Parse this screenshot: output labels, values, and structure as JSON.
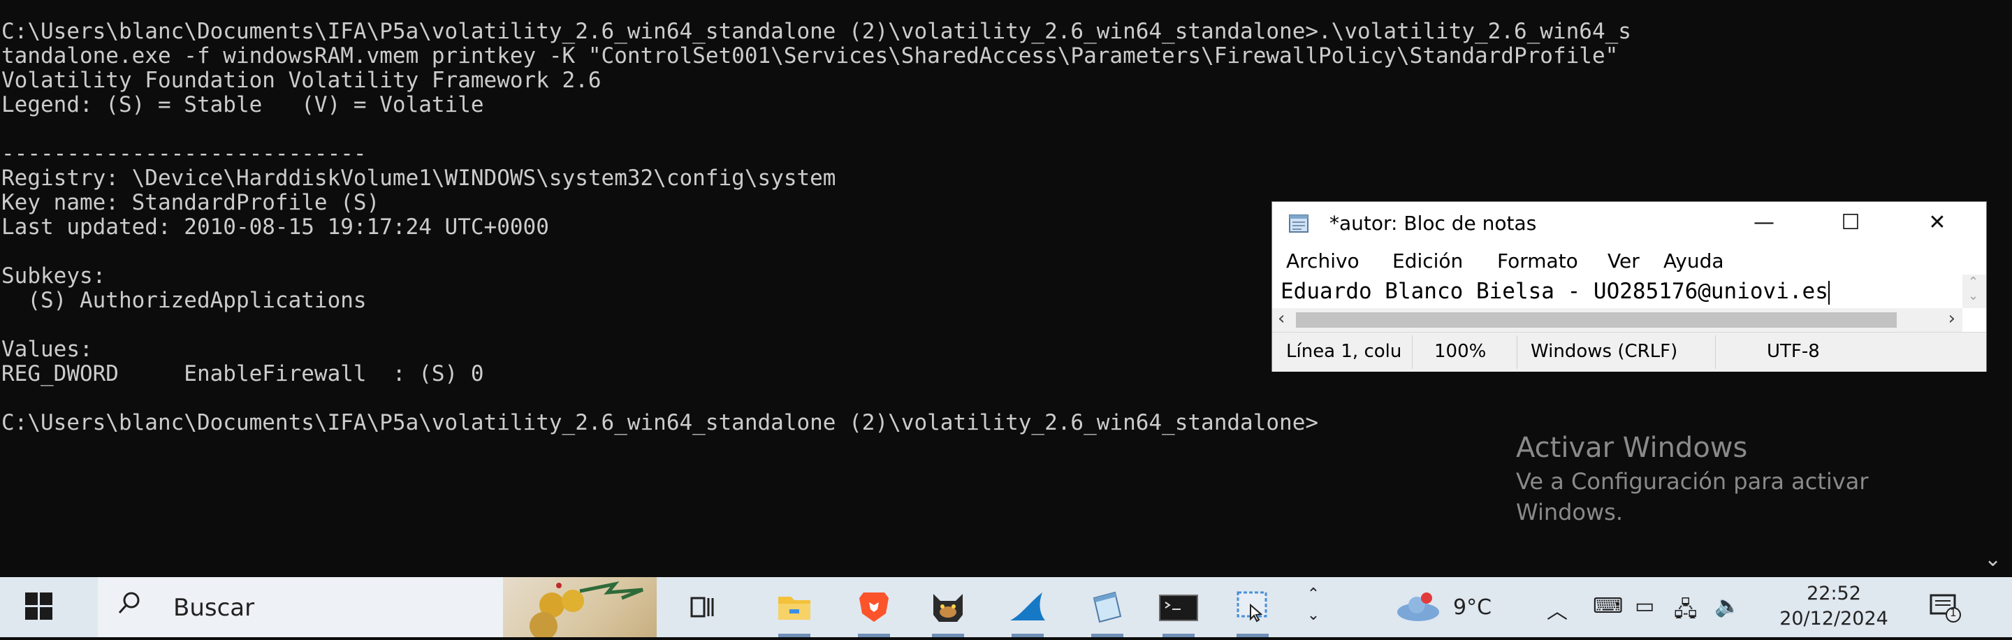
{
  "console": {
    "lines": [
      "C:\\Users\\blanc\\Documents\\IFA\\P5a\\volatility_2.6_win64_standalone (2)\\volatility_2.6_win64_standalone>.\\volatility_2.6_win64_s",
      "tandalone.exe -f windowsRAM.vmem printkey -K \"ControlSet001\\Services\\SharedAccess\\Parameters\\FirewallPolicy\\StandardProfile\"",
      "Volatility Foundation Volatility Framework 2.6",
      "Legend: (S) = Stable   (V) = Volatile",
      "",
      "----------------------------",
      "Registry: \\Device\\HarddiskVolume1\\WINDOWS\\system32\\config\\system",
      "Key name: StandardProfile (S)",
      "Last updated: 2010-08-15 19:17:24 UTC+0000",
      "",
      "Subkeys:",
      "  (S) AuthorizedApplications",
      "",
      "Values:",
      "REG_DWORD     EnableFirewall  : (S) 0",
      "",
      "C:\\Users\\blanc\\Documents\\IFA\\P5a\\volatility_2.6_win64_standalone (2)\\volatility_2.6_win64_standalone>"
    ],
    "background": "#0c0c0c",
    "foreground": "#cccccc"
  },
  "watermark": {
    "title": "Activar Windows",
    "subtitle": "Ve a Configuración para activar Windows."
  },
  "notepad": {
    "title": "*autor: Bloc de notas",
    "menu": [
      "Archivo",
      "Edición",
      "Formato",
      "Ver",
      "Ayuda"
    ],
    "content": "Eduardo Blanco Bielsa - UO285176@uniovi.es",
    "status": {
      "position": "Línea 1, colu",
      "zoom": "100%",
      "line_ending": "Windows (CRLF)",
      "encoding": "UTF-8"
    },
    "controls": {
      "minimize": "—",
      "maximize": "☐",
      "close": "✕"
    }
  },
  "taskbar": {
    "search_placeholder": "Buscar",
    "apps": [
      "task-view",
      "file-explorer",
      "brave-browser",
      "app-cat",
      "wireshark",
      "notepad",
      "terminal",
      "snipping-tool"
    ],
    "weather_temp": "9°C",
    "time": "22:52",
    "date": "20/12/2024",
    "notification_count": "1",
    "accent": "#6e8fb6"
  }
}
